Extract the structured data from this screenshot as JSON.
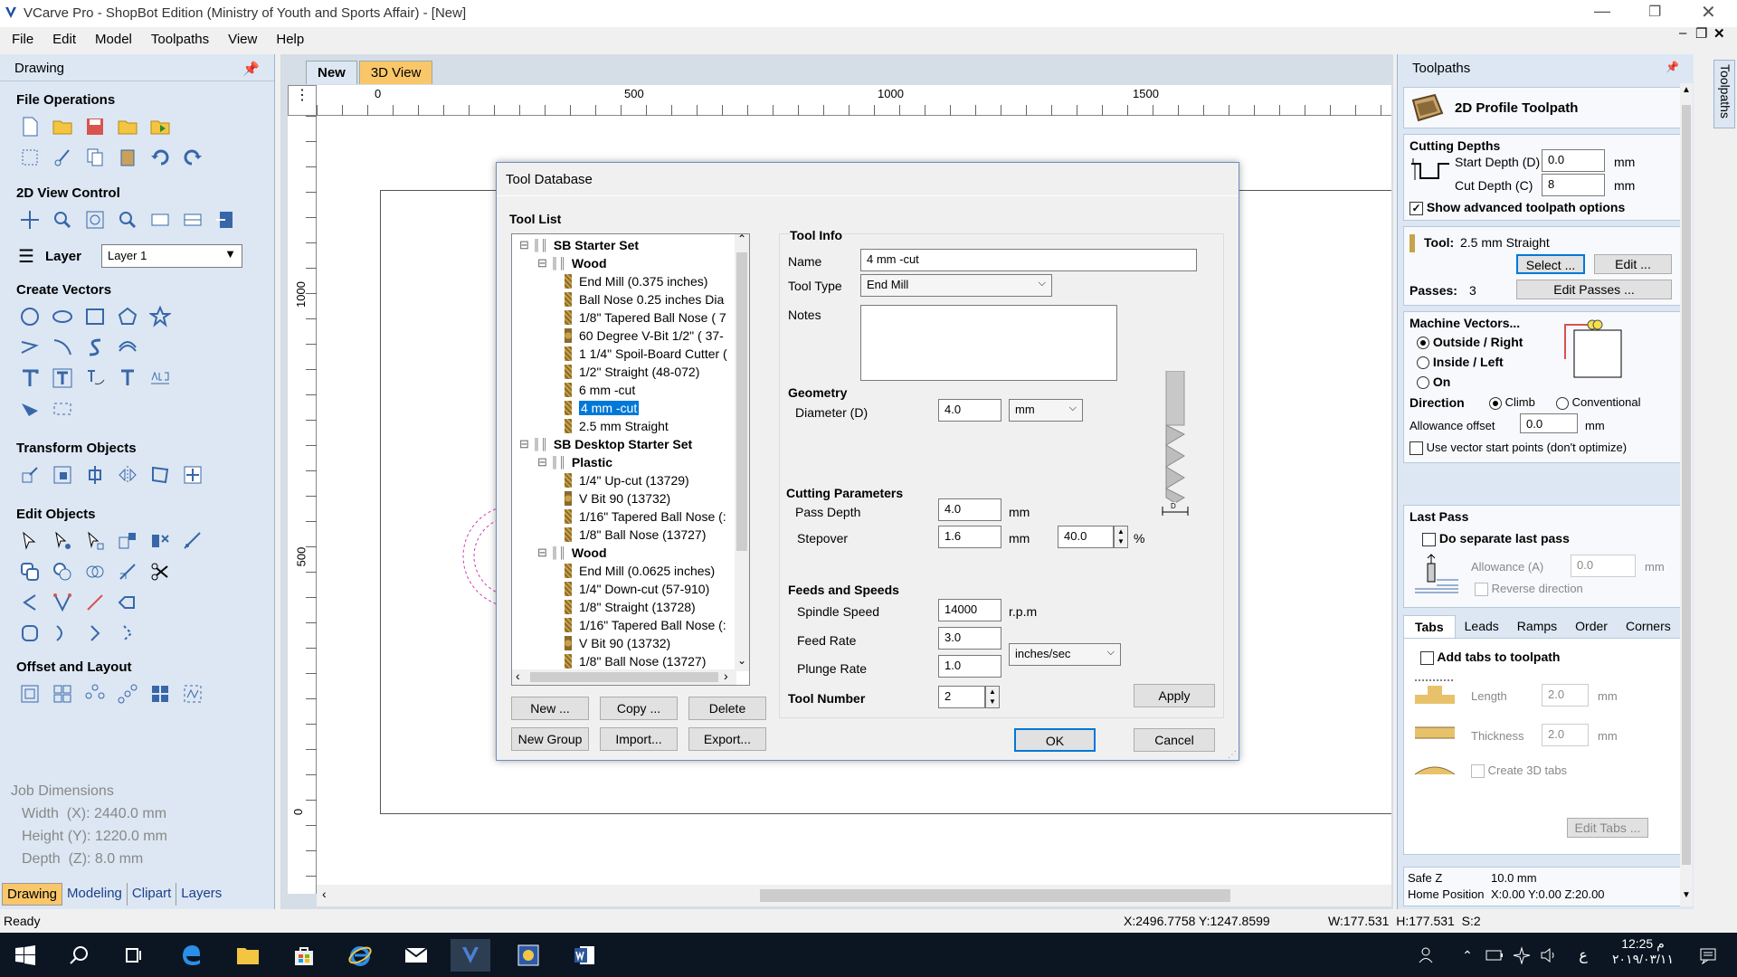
{
  "window": {
    "title": "VCarve Pro - ShopBot Edition (Ministry of Youth and Sports Affair) - [New]"
  },
  "menu": [
    "File",
    "Edit",
    "Model",
    "Toolpaths",
    "View",
    "Help"
  ],
  "left_panel": {
    "title": "Drawing",
    "sections": {
      "file_ops": "File Operations",
      "view_ctrl": "2D View Control",
      "layer_label": "Layer",
      "layer_value": "Layer 1",
      "create_vectors": "Create Vectors",
      "transform": "Transform Objects",
      "edit_objects": "Edit Objects",
      "offset_layout": "Offset and Layout"
    },
    "job": {
      "title": "Job Dimensions",
      "width": "Width  (X): 2440.0 mm",
      "height": "Height (Y): 1220.0 mm",
      "depth": "Depth  (Z): 8.0 mm"
    },
    "tabs": [
      "Drawing",
      "Modeling",
      "Clipart",
      "Layers"
    ]
  },
  "view_tabs": [
    "New",
    "3D View"
  ],
  "ruler": {
    "h": [
      "0",
      "500",
      "1000",
      "1500"
    ],
    "v": [
      "1000",
      "500",
      "0"
    ]
  },
  "dialog": {
    "title": "Tool Database",
    "tool_list_label": "Tool List",
    "tree": [
      {
        "level": 0,
        "text": "SB Starter Set",
        "bold": true,
        "type": "group"
      },
      {
        "level": 1,
        "text": "Wood",
        "bold": true,
        "type": "group"
      },
      {
        "level": 2,
        "text": "End Mill (0.375 inches)",
        "type": "tool"
      },
      {
        "level": 2,
        "text": "Ball Nose 0.25 inches Dia",
        "type": "tool"
      },
      {
        "level": 2,
        "text": "1/8\" Tapered Ball Nose ( 7",
        "type": "tool"
      },
      {
        "level": 2,
        "text": "60 Degree V-Bit 1/2\"  ( 37-",
        "type": "vbit"
      },
      {
        "level": 2,
        "text": "1 1/4\" Spoil-Board Cutter (",
        "type": "tool"
      },
      {
        "level": 2,
        "text": "1/2\" Straight  (48-072)",
        "type": "tool"
      },
      {
        "level": 2,
        "text": "6 mm  -cut",
        "type": "tool"
      },
      {
        "level": 2,
        "text": "4 mm -cut",
        "type": "tool",
        "selected": true
      },
      {
        "level": 2,
        "text": "2.5  mm Straight",
        "type": "tool"
      },
      {
        "level": 0,
        "text": "SB Desktop Starter Set",
        "bold": true,
        "type": "group"
      },
      {
        "level": 1,
        "text": "Plastic",
        "bold": true,
        "type": "group"
      },
      {
        "level": 2,
        "text": "1/4\" Up-cut (13729)",
        "type": "tool"
      },
      {
        "level": 2,
        "text": "V Bit 90 (13732)",
        "type": "vbit"
      },
      {
        "level": 2,
        "text": "1/16\" Tapered Ball Nose (:",
        "type": "tool"
      },
      {
        "level": 2,
        "text": "1/8\" Ball Nose (13727)",
        "type": "tool"
      },
      {
        "level": 1,
        "text": "Wood",
        "bold": true,
        "type": "group"
      },
      {
        "level": 2,
        "text": "End Mill (0.0625 inches)",
        "type": "tool"
      },
      {
        "level": 2,
        "text": "1/4\"  Down-cut (57-910)",
        "type": "tool"
      },
      {
        "level": 2,
        "text": "1/8\" Straight (13728)",
        "type": "tool"
      },
      {
        "level": 2,
        "text": "1/16\" Tapered Ball Nose (:",
        "type": "tool"
      },
      {
        "level": 2,
        "text": "V Bit 90 (13732)",
        "type": "vbit"
      },
      {
        "level": 2,
        "text": "1/8\" Ball Nose (13727)",
        "type": "tool"
      }
    ],
    "buttons": {
      "new": "New ...",
      "copy": "Copy ...",
      "delete": "Delete",
      "new_group": "New Group",
      "import": "Import...",
      "export": "Export...",
      "apply": "Apply",
      "ok": "OK",
      "cancel": "Cancel"
    },
    "tool_info": {
      "label": "Tool Info",
      "name_label": "Name",
      "name": "4 mm -cut",
      "type_label": "Tool Type",
      "type": "End Mill",
      "notes_label": "Notes"
    },
    "geometry": {
      "label": "Geometry",
      "diameter_label": "Diameter (D)",
      "diameter": "4.0",
      "unit": "mm",
      "d_marker": "D"
    },
    "cutting": {
      "label": "Cutting Parameters",
      "pass_depth_label": "Pass Depth",
      "pass_depth": "4.0",
      "pass_unit": "mm",
      "stepover_label": "Stepover",
      "stepover": "1.6",
      "stepover_unit": "mm",
      "stepover_pct": "40.0",
      "pct": "%"
    },
    "feeds": {
      "label": "Feeds and Speeds",
      "spindle_label": "Spindle Speed",
      "spindle": "14000",
      "spindle_unit": "r.p.m",
      "feed_label": "Feed Rate",
      "feed": "3.0",
      "plunge_label": "Plunge Rate",
      "plunge": "1.0",
      "rate_unit": "inches/sec"
    },
    "tool_number": {
      "label": "Tool Number",
      "value": "2"
    }
  },
  "right_panel": {
    "title": "Toolpaths",
    "vertical_tab": "Toolpaths",
    "heading": "2D Profile Toolpath",
    "depths": {
      "label": "Cutting Depths",
      "start_label": "Start Depth (D)",
      "start": "0.0",
      "cut_label": "Cut Depth (C)",
      "cut": "8",
      "unit": "mm",
      "advanced": "Show advanced toolpath options"
    },
    "tool": {
      "label": "Tool:",
      "value": "2.5  mm Straight",
      "select": "Select ...",
      "edit": "Edit ...",
      "passes_label": "Passes:",
      "passes": "3",
      "edit_passes": "Edit Passes ..."
    },
    "machine": {
      "label": "Machine Vectors...",
      "outside": "Outside / Right",
      "inside": "Inside / Left",
      "on": "On",
      "direction": "Direction",
      "climb": "Climb",
      "conventional": "Conventional",
      "allowance_label": "Allowance offset",
      "allowance": "0.0",
      "unit": "mm",
      "start_points": "Use vector start points (don't optimize)"
    },
    "last_pass": {
      "label": "Last Pass",
      "separate": "Do separate last pass",
      "allowance_label": "Allowance (A)",
      "allowance": "0.0",
      "unit": "mm",
      "reverse": "Reverse direction"
    },
    "tabs": [
      "Tabs",
      "Leads",
      "Ramps",
      "Order",
      "Corners"
    ],
    "tabs_panel": {
      "add": "Add tabs to toolpath",
      "length_label": "Length",
      "length": "2.0",
      "thickness_label": "Thickness",
      "thickness": "2.0",
      "unit": "mm",
      "create3d": "Create 3D tabs",
      "edit": "Edit Tabs ..."
    },
    "safe_z_label": "Safe Z",
    "safe_z": "10.0 mm",
    "home_label": "Home Position",
    "home": "X:0.00 Y:0.00 Z:20.00"
  },
  "status": {
    "ready": "Ready",
    "coords": "X:2496.7758 Y:1247.8599",
    "size": "W:177.531  H:177.531  S:2"
  },
  "taskbar": {
    "time": "12:25 م",
    "date": "۲۰۱۹/۰۳/۱۱",
    "lang": "ع"
  }
}
